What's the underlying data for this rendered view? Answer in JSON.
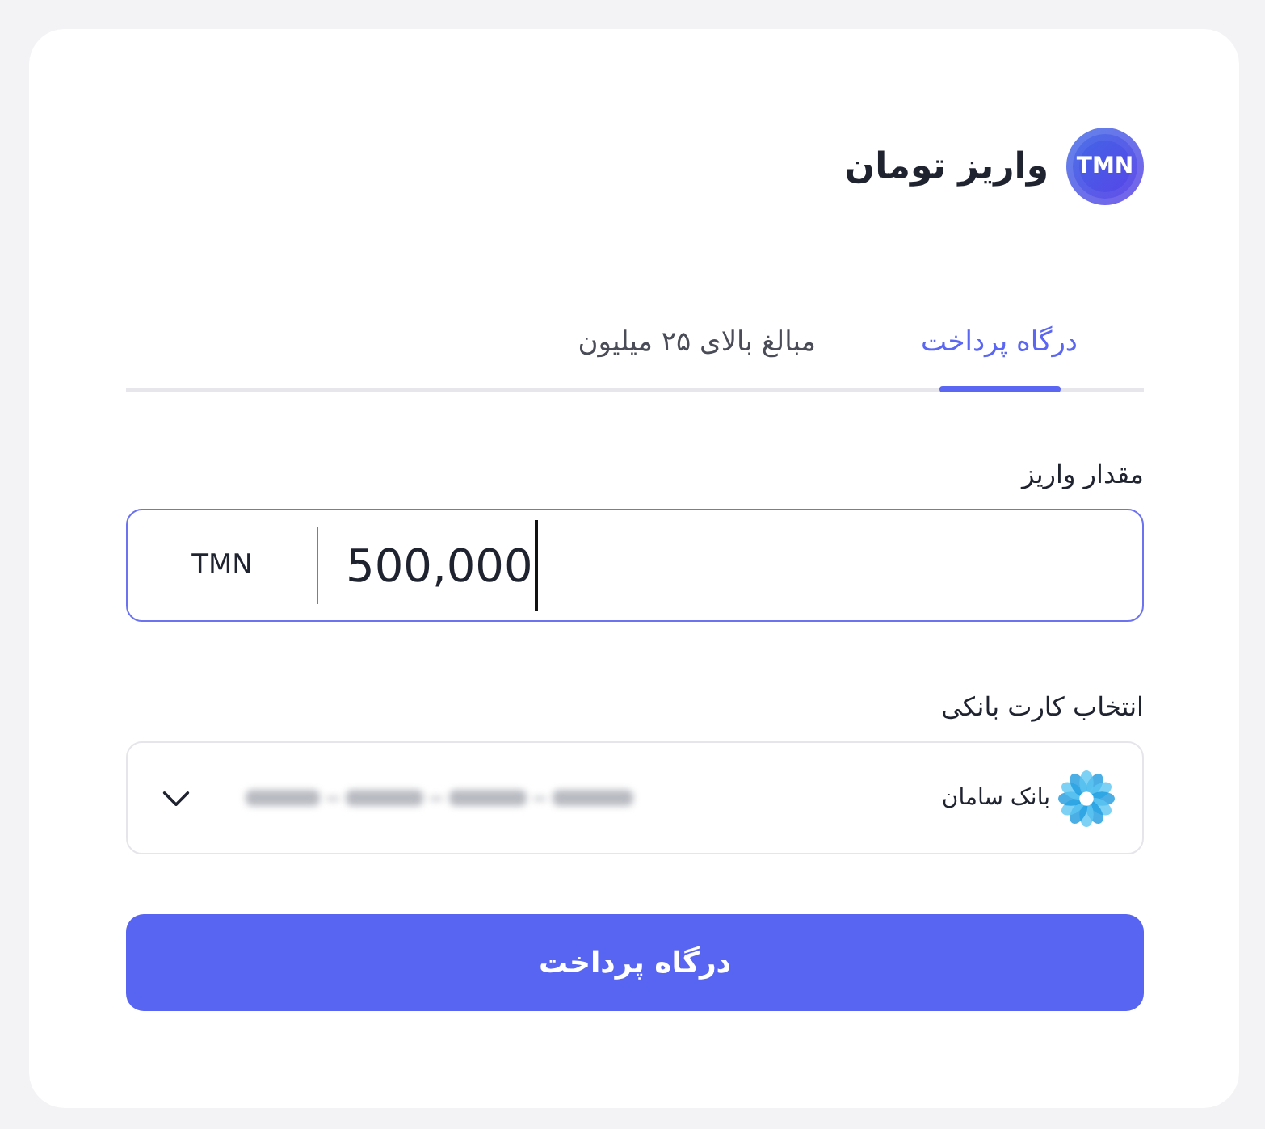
{
  "header": {
    "logo_text": "TMN",
    "title": "واریز تومان"
  },
  "tabs": [
    {
      "label": "درگاه پرداخت",
      "selected": true
    },
    {
      "label": "مبالغ بالای ۲۵ میلیون",
      "selected": false
    }
  ],
  "amount": {
    "label": "مقدار واریز",
    "currency": "TMN",
    "value": "500,000",
    "focused": true
  },
  "bank_card": {
    "label": "انتخاب کارت بانکی",
    "bank_name": "بانک سامان"
  },
  "submit_button": {
    "label": "درگاه پرداخت"
  }
}
